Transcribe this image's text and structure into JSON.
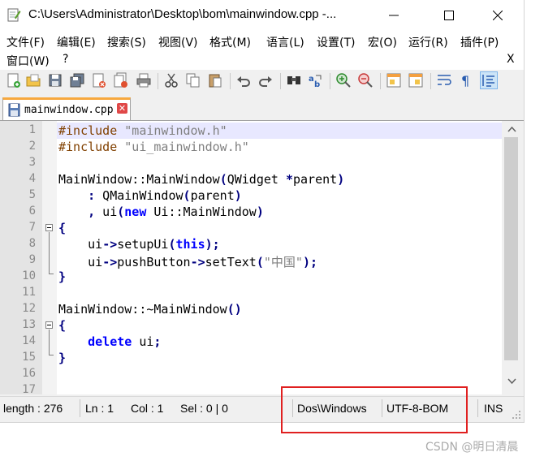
{
  "window": {
    "title": "C:\\Users\\Administrator\\Desktop\\bom\\mainwindow.cpp -...",
    "minimize_glyph": "—",
    "maximize_glyph": "☐",
    "close_glyph": "✕"
  },
  "menu": {
    "items": [
      "文件(F)",
      "编辑(E)",
      "搜索(S)",
      "视图(V)",
      "格式(M)",
      "语言(L)",
      "设置(T)",
      "宏(O)",
      "运行(R)",
      "插件(P)"
    ],
    "row2": [
      "窗口(W)",
      "?"
    ],
    "close_doc": "X"
  },
  "toolbar": {
    "icons": [
      "new-file-icon",
      "open-file-icon",
      "save-icon",
      "save-all-icon",
      "close-icon",
      "close-all-icon",
      "print-icon",
      "cut-icon",
      "copy-icon",
      "paste-icon",
      "undo-icon",
      "redo-icon",
      "find-icon",
      "replace-icon",
      "zoom-in-icon",
      "zoom-out-icon",
      "sync-vertical-icon",
      "sync-horizontal-icon",
      "word-wrap-icon",
      "show-all-chars-icon",
      "indent-guide-icon"
    ]
  },
  "tabs": [
    {
      "label": "mainwindow.cpp",
      "close": "✕"
    }
  ],
  "editor": {
    "line_numbers": [
      "1",
      "2",
      "3",
      "4",
      "5",
      "6",
      "7",
      "8",
      "9",
      "10",
      "11",
      "12",
      "13",
      "14",
      "15",
      "16",
      "17"
    ]
  },
  "status": {
    "length": "length : 276",
    "ln": "Ln : 1",
    "col": "Col : 1",
    "sel": "Sel : 0 | 0",
    "eol": "Dos\\Windows",
    "encoding": "UTF-8-BOM",
    "mode": "INS"
  },
  "watermark": "CSDN @明日清晨",
  "colors": {
    "keyword": "#0000ff",
    "preprocessor": "#804000",
    "string": "#808080",
    "operator": "#000080",
    "current_line": "#e8e8ff",
    "highlight_box": "#e02020",
    "tab_accent": "#f7a83e"
  }
}
